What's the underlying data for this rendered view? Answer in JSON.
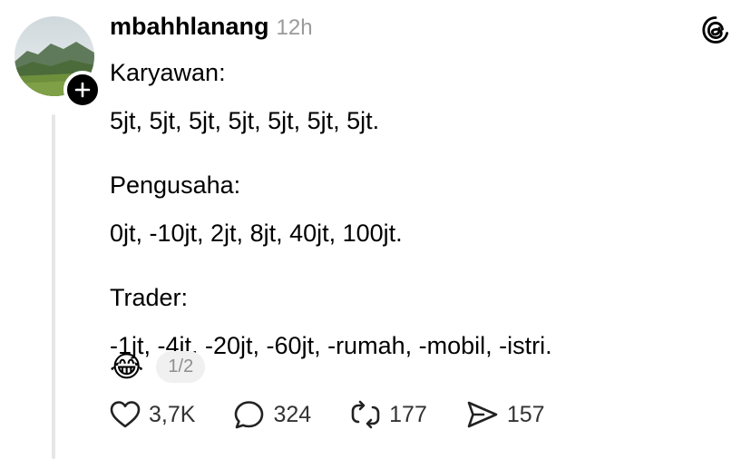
{
  "post": {
    "username": "mbahhlanang",
    "time_ago": "12h",
    "lines": {
      "karyawan_label": "Karyawan:",
      "karyawan_values": "5jt, 5jt, 5jt, 5jt, 5jt, 5jt, 5jt.",
      "pengusaha_label": "Pengusaha:",
      "pengusaha_values": "0jt, -10jt, 2jt, 8jt, 40jt, 100jt.",
      "trader_label": "Trader:",
      "trader_values": "-1jt, -4jt, -20jt, -60jt, -rumah, -mobil, -istri."
    },
    "emoji": "😂",
    "page_indicator": "1/2"
  },
  "actions": {
    "likes": "3,7K",
    "replies": "324",
    "reposts": "177",
    "shares": "157"
  },
  "icons": {
    "avatar": "landscape-avatar",
    "follow": "plus-icon",
    "logo": "threads-logo-icon",
    "like": "heart-icon",
    "reply": "comment-icon",
    "repost": "repost-icon",
    "share": "send-icon"
  },
  "colors": {
    "text": "#000000",
    "muted": "#9a9a9a",
    "thread_line": "#e6e6e6",
    "pill_bg": "#f0f0f0"
  }
}
